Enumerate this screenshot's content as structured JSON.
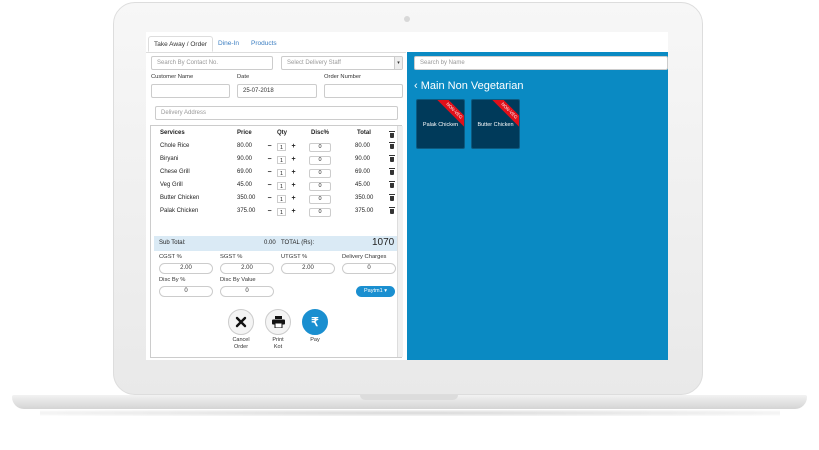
{
  "tabs": [
    "Take Away / Order",
    "Dine-In",
    "Products"
  ],
  "form": {
    "contact_placeholder": "Search By Contact No.",
    "staff_placeholder": "Select Delivery Staff",
    "customer_label": "Customer Name",
    "date_label": "Date",
    "date_value": "25-07-2018",
    "order_label": "Order Number",
    "address_placeholder": "Delivery Address"
  },
  "table": {
    "headers": [
      "Services",
      "Price",
      "Qty",
      "Disc%",
      "Total"
    ],
    "rows": [
      {
        "name": "Chole Rice",
        "price": "80.00",
        "qty": "1",
        "disc": "0",
        "total": "80.00"
      },
      {
        "name": "Biryani",
        "price": "90.00",
        "qty": "1",
        "disc": "0",
        "total": "90.00"
      },
      {
        "name": "Chese Grill",
        "price": "69.00",
        "qty": "1",
        "disc": "0",
        "total": "69.00"
      },
      {
        "name": "Veg Grill",
        "price": "45.00",
        "qty": "1",
        "disc": "0",
        "total": "45.00"
      },
      {
        "name": "Butter Chicken",
        "price": "350.00",
        "qty": "1",
        "disc": "0",
        "total": "350.00"
      },
      {
        "name": "Palak Chicken",
        "price": "375.00",
        "qty": "1",
        "disc": "0",
        "total": "375.00"
      }
    ]
  },
  "summary": {
    "subtotal_label": "Sub Total:",
    "subtotal_value": "0.00",
    "total_label": "TOTAL (Rs):",
    "total_value": "1070"
  },
  "taxes": {
    "cgst_label": "CGST %",
    "cgst_value": "2.00",
    "sgst_label": "SGST %",
    "sgst_value": "2.00",
    "utgst_label": "UTGST %",
    "utgst_value": "2.00",
    "delivery_label": "Delivery Charges",
    "delivery_value": "0",
    "disc_pct_label": "Disc By %",
    "disc_pct_value": "0",
    "disc_val_label": "Disc By Value",
    "disc_val_value": "0",
    "payment_method": "Paytm1"
  },
  "actions": {
    "cancel_line1": "Cancel",
    "cancel_line2": "Order",
    "print_line1": "Print",
    "print_line2": "Kot",
    "pay": "Pay"
  },
  "products": {
    "search_placeholder": "Search by Name",
    "category_title": "Main Non Vegetarian",
    "items": [
      {
        "name": "Palak Chicken",
        "badge": "NON-VEG"
      },
      {
        "name": "Butter Chicken",
        "badge": "NON-VEG"
      }
    ]
  },
  "colors": {
    "accent": "#0a8ac3",
    "card": "#003a5a",
    "badge": "#e0101a"
  }
}
